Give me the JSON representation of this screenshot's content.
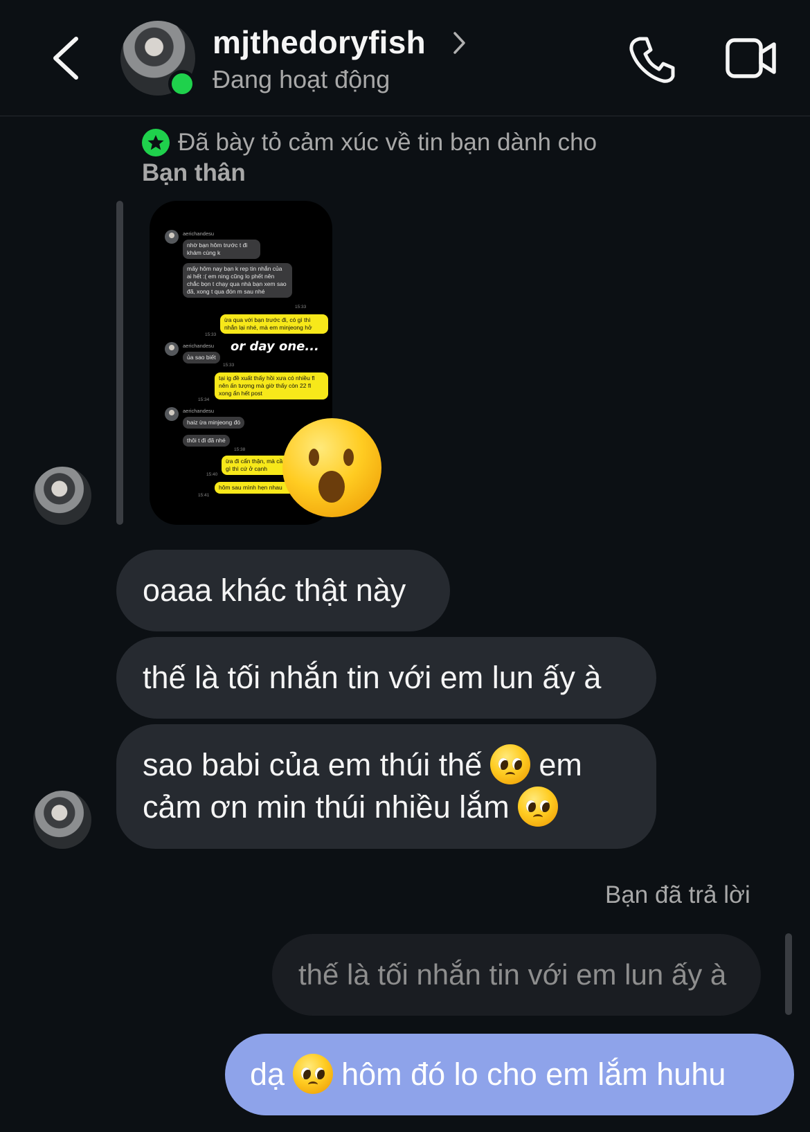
{
  "header": {
    "username": "mjthedoryfish",
    "status": "Đang hoạt động"
  },
  "story_reaction": {
    "notice": "Đã bày tỏ cảm xúc về tin bạn dành cho",
    "audience": "Bạn thân",
    "reaction_emoji": "hushed-face",
    "story": {
      "overlay_text": "or day one...",
      "messages": [
        {
          "side": "left",
          "name": "aerichandesu",
          "text": "nhờ bạn hôm trước t đi khám cùng k"
        },
        {
          "side": "left",
          "text": "mấy hôm nay bạn k rep tin nhắn của ai hết :( em ning cũng lo phết nên chắc bọn t chạy qua nhà bạn xem sao đã, xong t qua đón m sau nhé",
          "time": "15:33"
        },
        {
          "side": "right",
          "text": "ừa qua với bạn trước đi, có gì thì nhắn lại nhé, mà em minjeong hở",
          "time": "15:33"
        },
        {
          "side": "left",
          "name": "aerichandesu",
          "text": "ủa sao biết",
          "time": "15:33"
        },
        {
          "side": "right",
          "text": "tại ig đề xuất thấy hồi xưa có nhiều fl nên ấn tượng mà giờ thấy còn 22 fl xong ẩn hết post",
          "time": "15:34"
        },
        {
          "side": "left",
          "name": "aerichandesu",
          "text": "haiz ừa minjeong đó"
        },
        {
          "side": "left",
          "text": "thôi t đi đã nhé",
          "time": "15:38"
        },
        {
          "side": "right",
          "text": "ừa đi cẩn thận, mà cần gì thì cứ ở cạnh",
          "time": "15:40"
        },
        {
          "side": "right",
          "text": "hôm sau mình hẹn nhau",
          "time": "15:41"
        }
      ]
    }
  },
  "messages": [
    {
      "text": "oaaa khác thật này"
    },
    {
      "text": "thế là tối nhắn tin với em lun ấy à"
    },
    {
      "line1_a": "sao babi của em thúi thế",
      "line1_b": "em",
      "line2": "cảm ơn min thúi nhiều lắm",
      "emoji": "pleading-face"
    }
  ],
  "reply": {
    "label": "Bạn đã trả lời",
    "quoted": "thế là tối nhắn tin với em lun ấy à",
    "sent_a": "dạ",
    "sent_b": "hôm đó lo cho em lắm huhu",
    "emoji": "pleading-face"
  }
}
